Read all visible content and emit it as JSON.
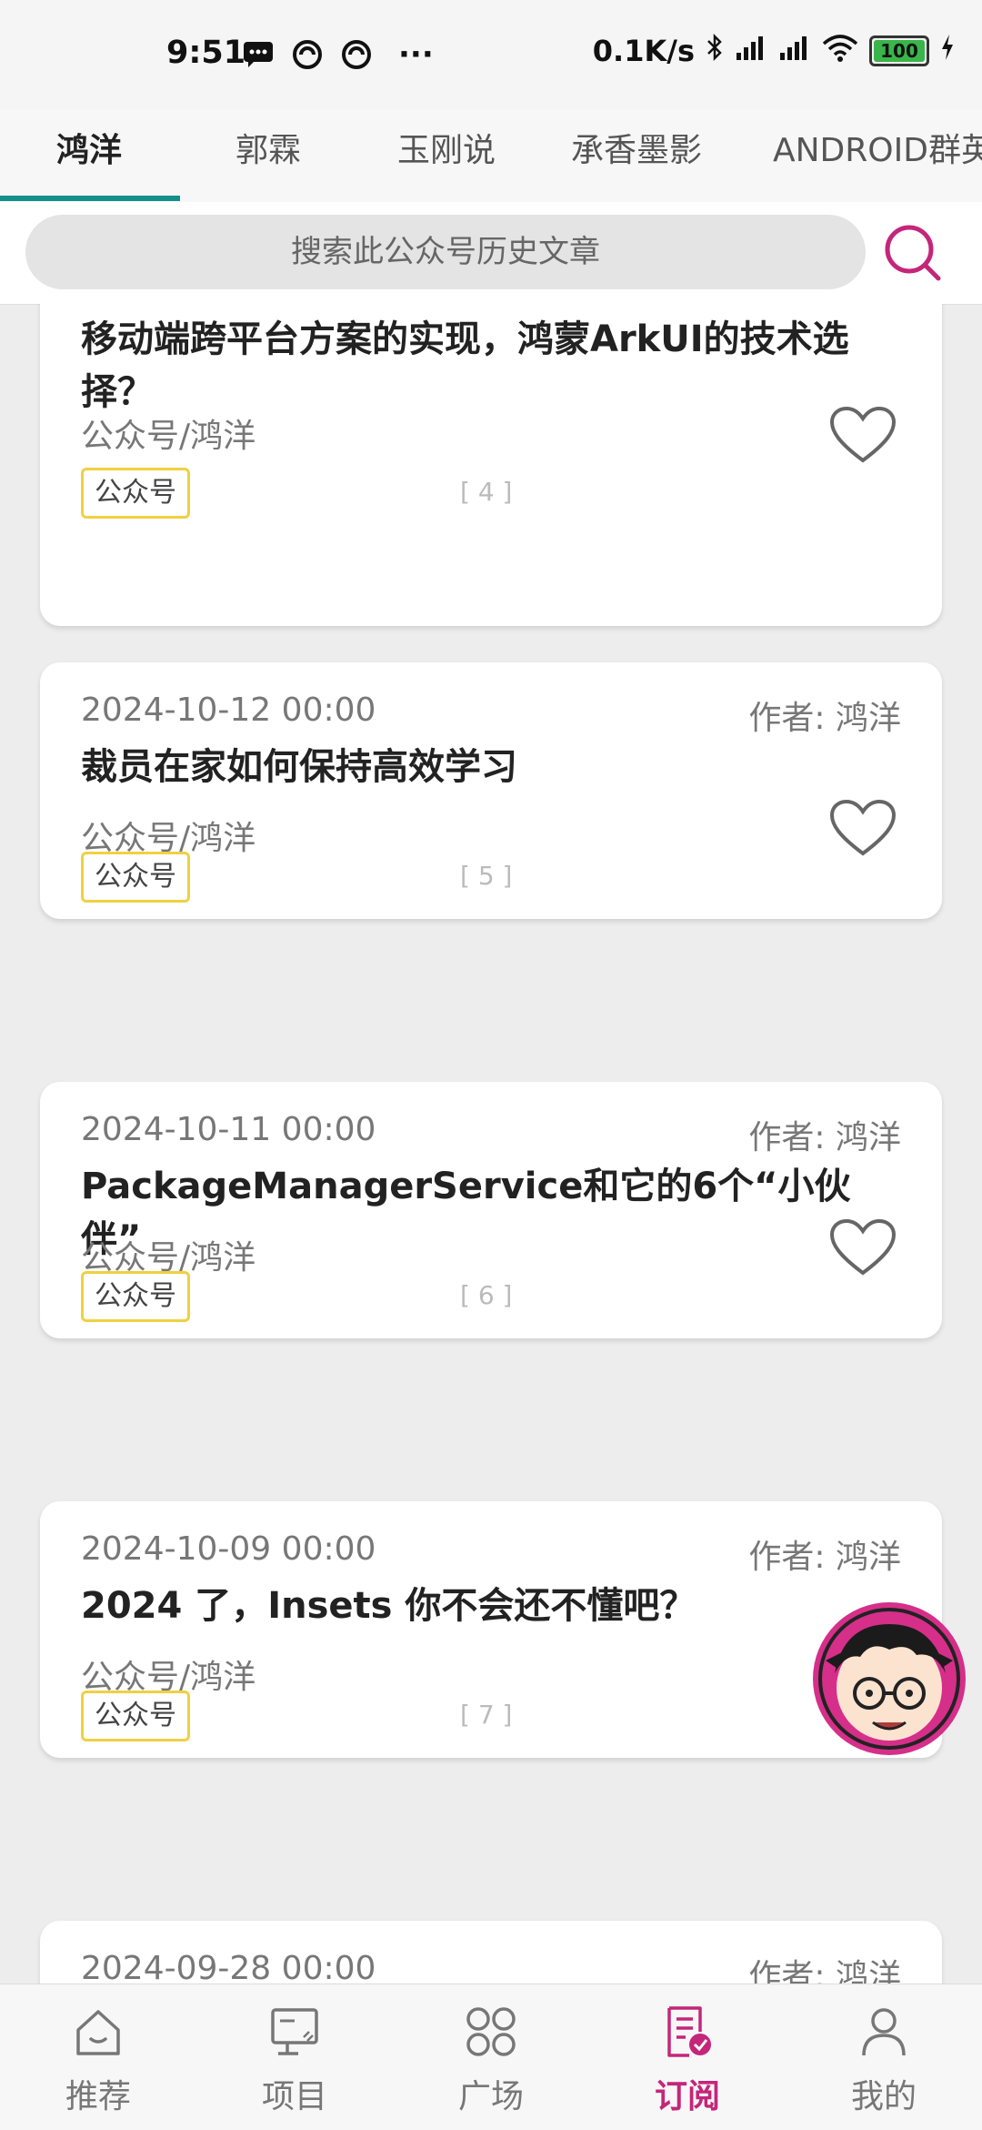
{
  "status_bar": {
    "time": "9:51",
    "net_speed": "0.1K/s",
    "battery": "100",
    "more": "···"
  },
  "tabs": [
    {
      "label": "鸿洋",
      "active": true
    },
    {
      "label": "郭霖"
    },
    {
      "label": "玉刚说"
    },
    {
      "label": "承香墨影"
    },
    {
      "label": "ANDROID群英传"
    }
  ],
  "search": {
    "placeholder": "搜索此公众号历史文章"
  },
  "articles": [
    {
      "date": "",
      "author": "",
      "title": "移动端跨平台方案的实现，鸿蒙ArkUI的技术选择？",
      "source": "公众号/鸿洋",
      "tag": "公众号",
      "index": "[ 4 ]"
    },
    {
      "date": "2024-10-12 00:00",
      "author": "作者: 鸿洋",
      "title": "裁员在家如何保持高效学习",
      "source": "公众号/鸿洋",
      "tag": "公众号",
      "index": "[ 5 ]"
    },
    {
      "date": "2024-10-11 00:00",
      "author": "作者: 鸿洋",
      "title": "PackageManagerService和它的6个“小伙伴”",
      "source": "公众号/鸿洋",
      "tag": "公众号",
      "index": "[ 6 ]"
    },
    {
      "date": "2024-10-09 00:00",
      "author": "作者: 鸿洋",
      "title": "2024 了，Insets 你不会还不懂吧？",
      "source": "公众号/鸿洋",
      "tag": "公众号",
      "index": "[ 7 ]"
    },
    {
      "date": "2024-09-28 00:00",
      "author": "作者: 鸿洋"
    }
  ],
  "bottom_nav": [
    {
      "label": "推荐",
      "icon": "home-icon"
    },
    {
      "label": "项目",
      "icon": "project-icon"
    },
    {
      "label": "广场",
      "icon": "grid-icon"
    },
    {
      "label": "订阅",
      "icon": "subscribe-icon",
      "active": true
    },
    {
      "label": "我的",
      "icon": "profile-icon"
    }
  ],
  "colors": {
    "accent": "#c4267a",
    "tab_indicator": "#148f8a",
    "tag_border": "#f0d040"
  }
}
